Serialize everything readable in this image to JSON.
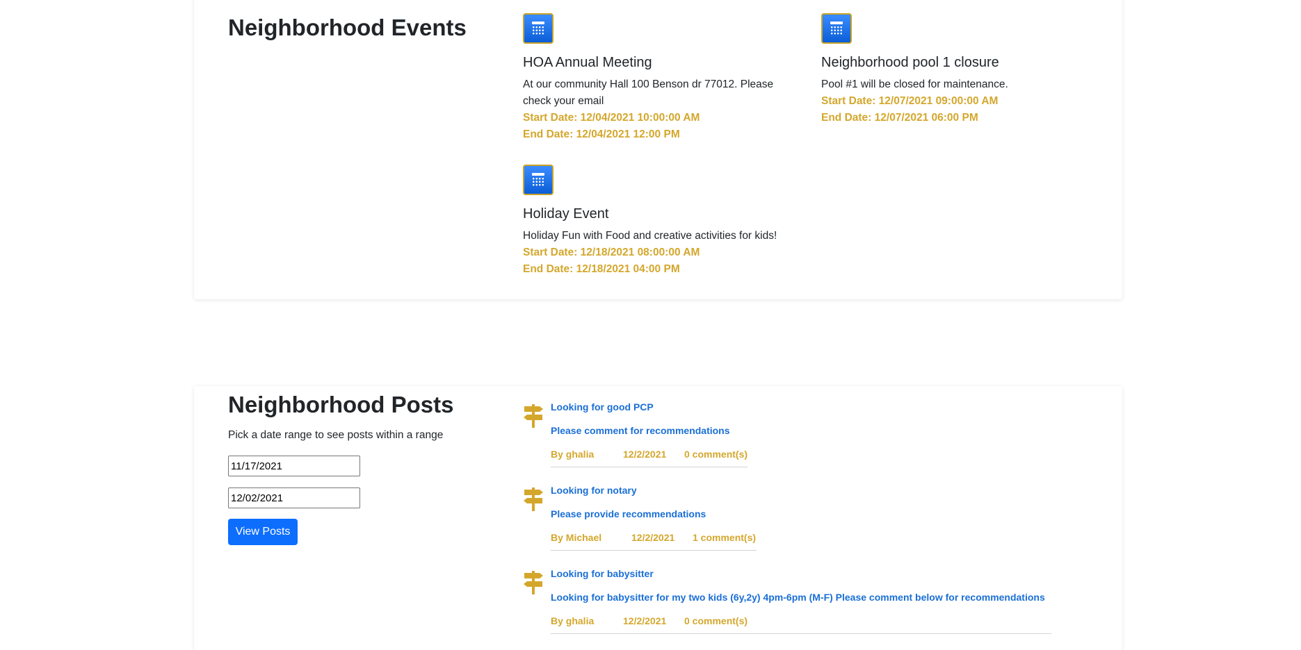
{
  "events": {
    "title": "Neighborhood Events",
    "items": [
      {
        "title": "HOA Annual Meeting",
        "description": "At our community Hall 100 Benson dr 77012. Please check your email",
        "start": "Start Date: 12/04/2021 10:00:00 AM",
        "end": "End Date: 12/04/2021 12:00 PM"
      },
      {
        "title": "Neighborhood pool 1 closure",
        "description": "Pool #1 will be closed for maintenance.",
        "start": "Start Date: 12/07/2021 09:00:00 AM",
        "end": "End Date: 12/07/2021 06:00 PM"
      },
      {
        "title": "Holiday Event",
        "description": "Holiday Fun with Food and creative activities for kids!",
        "start": "Start Date: 12/18/2021 08:00:00 AM",
        "end": "End Date: 12/18/2021 04:00 PM"
      }
    ]
  },
  "posts": {
    "title": "Neighborhood Posts",
    "subtitle": "Pick a date range to see posts within a range",
    "date_from": "11/17/2021",
    "date_to": "12/02/2021",
    "view_button": "View Posts",
    "items": [
      {
        "title": "Looking for good PCP",
        "text": "Please comment for recommendations",
        "author": "By ghalia",
        "date": "12/2/2021",
        "comments": "0 comment(s)"
      },
      {
        "title": "Looking for notary",
        "text": "Please provide recommendations",
        "author": "By Michael",
        "date": "12/2/2021",
        "comments": "1 comment(s)"
      },
      {
        "title": "Looking for babysitter",
        "text": "Looking for babysitter for my two kids (6y,2y) 4pm-6pm (M-F) Please comment below for recommendations",
        "author": "By ghalia",
        "date": "12/2/2021",
        "comments": "0 comment(s)"
      }
    ]
  },
  "colors": {
    "accent_gold": "#d4a72c",
    "link_blue": "#1a6fd6",
    "button_blue": "#0d6efd"
  },
  "icons": {
    "event_icon": "calendar-icon",
    "post_icon": "signpost-icon"
  }
}
